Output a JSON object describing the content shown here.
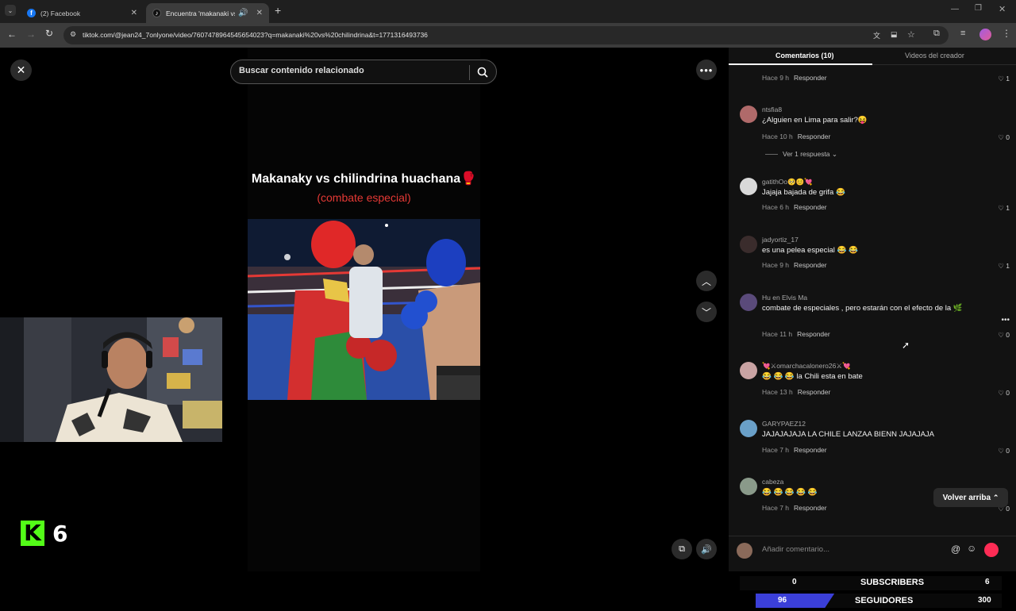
{
  "browser": {
    "tabs": [
      {
        "title": "(2) Facebook",
        "active": false
      },
      {
        "title": "Encuentra 'makanaki vs chili",
        "active": true
      }
    ],
    "url": "tiktok.com/@jean24_7onlyone/video/7607478964545654023?q=makanaki%20vs%20chilindrina&t=1771316493736"
  },
  "search": {
    "placeholder": "Buscar contenido relacionado"
  },
  "video": {
    "title": "Makanaky vs chilindrina huachana🥊",
    "subtitle": "(combate especial)"
  },
  "panel": {
    "tab_comments": "Comentarios (10)",
    "tab_creator": "Videos del creador",
    "reply_label": "Responder",
    "view_replies": "Ver 1 respuesta",
    "back_to_top": "Volver arriba",
    "input_placeholder": "Añadir comentario..."
  },
  "comments": [
    {
      "user": "",
      "text": "",
      "time": "Hace 9 h",
      "likes": "1",
      "avatar_color": "#777"
    },
    {
      "user": "ntsfia8",
      "text": "¿Alguien en Lima para salir?😝",
      "time": "Hace 10 h",
      "likes": "0",
      "avatar_color": "#b06a6a"
    },
    {
      "user": "gatithOo🥺😊💘",
      "text": "Jajaja bajada de grifa 😂",
      "time": "Hace 6 h",
      "likes": "1",
      "avatar_color": "#d9d9d9"
    },
    {
      "user": "jadyortiz_17",
      "text": "es una pelea especial 😂 😂",
      "time": "Hace 9 h",
      "likes": "1",
      "avatar_color": "#3a2c2c"
    },
    {
      "user": "Hu en Elvis Ma",
      "text": "combate de especiales , pero estarán con el efecto de la 🌿",
      "time": "Hace 11 h",
      "likes": "0",
      "avatar_color": "#5a4a7a"
    },
    {
      "user": "💘⚔omarchacalonero26⚔💘",
      "text": "😂 😂 😂 la Chili esta en bate",
      "time": "Hace 13 h",
      "likes": "0",
      "avatar_color": "#c9a3a3"
    },
    {
      "user": "GARYPAEZ12",
      "text": "JAJAJAJAJA LA CHILE LANZAA BIENN JAJAJAJA",
      "time": "Hace 7 h",
      "likes": "0",
      "avatar_color": "#6aa0c8"
    },
    {
      "user": "cabeza",
      "text": "😂 😂 😂 😂 😂",
      "time": "Hace 7 h",
      "likes": "0",
      "avatar_color": "#8a9a8a"
    }
  ],
  "overlay": {
    "subscribers_label": "SUBSCRIBERS",
    "subscribers_left": "0",
    "subscribers_right": "6",
    "followers_label": "SEGUIDORES",
    "followers_left": "96",
    "followers_right": "300",
    "followers_progress": 0.32
  },
  "stream_badge": {
    "letter": "K",
    "number": "6"
  },
  "colors": {
    "accent": "#fe2c55",
    "kick_green": "#53fc18",
    "overlay_bar": "#3b3fd8"
  }
}
